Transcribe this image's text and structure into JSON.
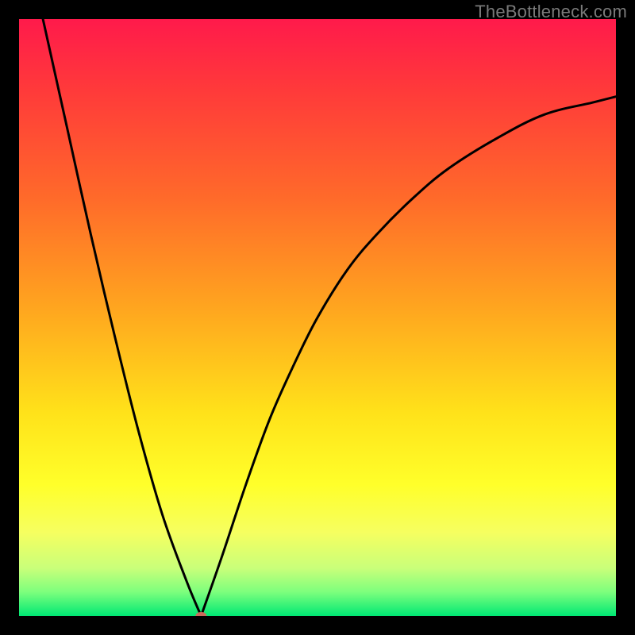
{
  "watermark": "TheBottleneck.com",
  "chart_data": {
    "type": "line",
    "title": "",
    "xlabel": "",
    "ylabel": "",
    "xlim": [
      0,
      100
    ],
    "ylim": [
      0,
      100
    ],
    "grid": false,
    "legend": false,
    "gradient_stops": [
      {
        "pct": 0,
        "color": "#ff1a4b"
      },
      {
        "pct": 12,
        "color": "#ff3a3a"
      },
      {
        "pct": 30,
        "color": "#ff6a2a"
      },
      {
        "pct": 48,
        "color": "#ffa41f"
      },
      {
        "pct": 66,
        "color": "#ffe21a"
      },
      {
        "pct": 78,
        "color": "#ffff2a"
      },
      {
        "pct": 86,
        "color": "#f6ff60"
      },
      {
        "pct": 92,
        "color": "#c9ff7a"
      },
      {
        "pct": 96,
        "color": "#7dff7d"
      },
      {
        "pct": 100,
        "color": "#00e874"
      }
    ],
    "series": [
      {
        "name": "left-branch",
        "x": [
          4,
          8,
          12,
          16,
          20,
          24,
          28,
          30.5
        ],
        "values": [
          100,
          82,
          64,
          47,
          31,
          17,
          6,
          0
        ]
      },
      {
        "name": "right-branch",
        "x": [
          30.5,
          34,
          38,
          42,
          46,
          50,
          55,
          60,
          66,
          72,
          80,
          88,
          96,
          100
        ],
        "values": [
          0,
          10,
          22,
          33,
          42,
          50,
          58,
          64,
          70,
          75,
          80,
          84,
          86,
          87
        ]
      }
    ],
    "marker": {
      "x": 30.5,
      "y": 0,
      "color": "#cc6a5c",
      "rx": 7,
      "ry": 5
    }
  }
}
